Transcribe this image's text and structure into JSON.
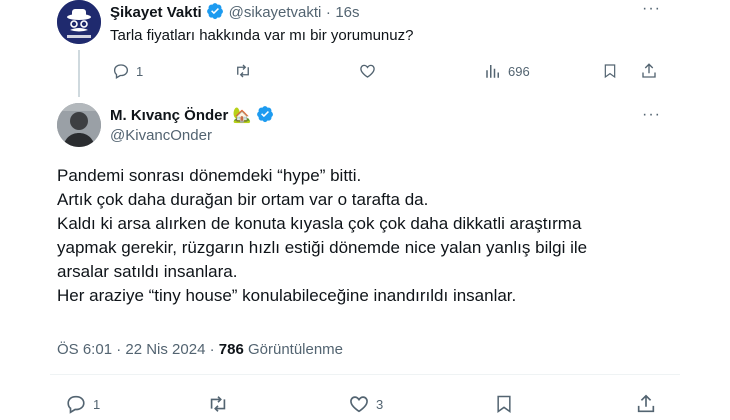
{
  "reply_to": {
    "name": "Şikayet Vakti",
    "handle": "@sikayetvakti",
    "separator": "·",
    "time": "16s",
    "text": "Tarla fiyatları hakkında var mı bir yorumunuz?",
    "actions": {
      "replies": "1",
      "views": "696"
    }
  },
  "tweet": {
    "name": "M. Kıvanç Önder",
    "name_emoji": "🏡",
    "handle": "@KivancOnder",
    "lines": [
      "Pandemi sonrası dönemdeki “hype” bitti.",
      "Artık çok daha durağan bir ortam var o tarafta da.",
      "Kaldı ki arsa alırken de konuta kıyasla çok çok daha dikkatli araştırma",
      "yapmak gerekir, rüzgarın hızlı estiği dönemde nice yalan yanlış bilgi ile",
      "arsalar satıldı insanlara.",
      "Her araziye “tiny house” konulabileceğine inandırıldı insanlar."
    ],
    "timestamp": "ÖS 6:01 · 22 Nis 2024 ·",
    "views_count": "786",
    "views_label": "Görüntülenme",
    "actions": {
      "replies": "1",
      "likes": "3"
    }
  },
  "colors": {
    "verified": "#1d9bf0",
    "text": "#0f1419",
    "secondary": "#536471"
  }
}
